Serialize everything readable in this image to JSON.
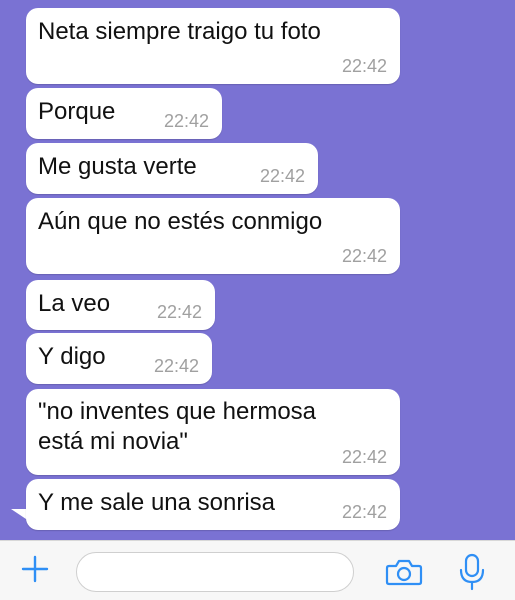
{
  "chat": {
    "messages": [
      {
        "text": "Neta siempre traigo tu foto",
        "time": "22:42"
      },
      {
        "text": "Porque",
        "time": "22:42"
      },
      {
        "text": "Me gusta verte",
        "time": "22:42"
      },
      {
        "text": "Aún que no estés conmigo",
        "time": "22:42"
      },
      {
        "text": "La veo",
        "time": "22:42"
      },
      {
        "text": "Y digo",
        "time": "22:42"
      },
      {
        "text": "\"no inventes que hermosa\nestá mi novia\"",
        "time": "22:42"
      },
      {
        "text": "Y me sale una sonrisa",
        "time": "22:42"
      }
    ]
  },
  "input_bar": {
    "value": "",
    "icons": [
      "plus-icon",
      "camera-icon",
      "microphone-icon"
    ],
    "accent_color": "#2f8ff5"
  },
  "colors": {
    "chat_background": "#7a72d3",
    "bubble": "#ffffff",
    "timestamp": "#a0a0a0"
  }
}
